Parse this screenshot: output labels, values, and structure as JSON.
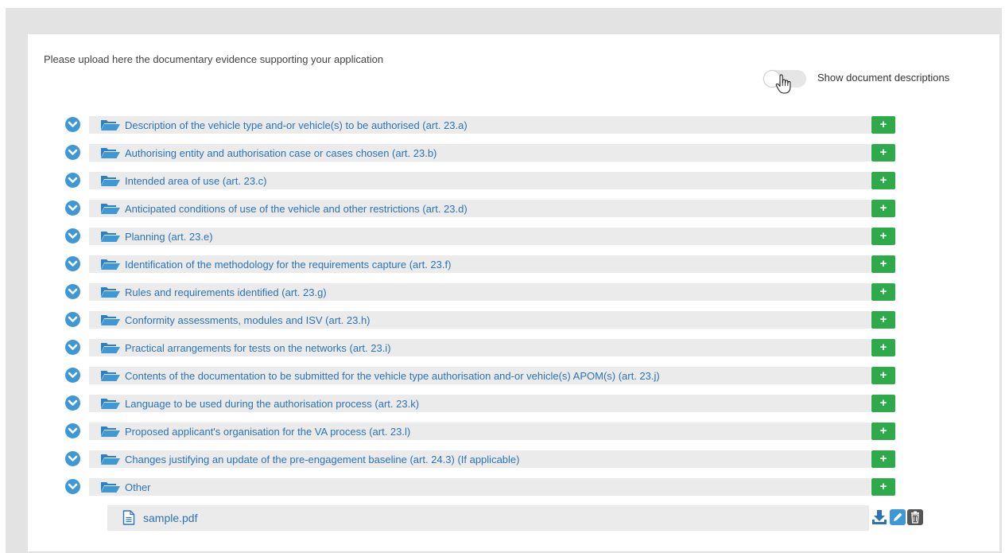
{
  "intro_text": "Please upload here the documentary evidence supporting your application",
  "toggle": {
    "label": "Show document descriptions",
    "enabled": false
  },
  "folders": [
    {
      "label": "Description of the vehicle type and-or vehicle(s) to be authorised (art. 23.a)"
    },
    {
      "label": "Authorising entity and authorisation case or cases chosen (art. 23.b)"
    },
    {
      "label": "Intended area of use (art. 23.c)"
    },
    {
      "label": "Anticipated conditions of use of the vehicle and other restrictions (art. 23.d)"
    },
    {
      "label": "Planning (art. 23.e)"
    },
    {
      "label": "Identification of the methodology for the requirements capture (art. 23.f)"
    },
    {
      "label": "Rules and requirements identified (art. 23.g)"
    },
    {
      "label": "Conformity assessments, modules and ISV (art. 23.h)"
    },
    {
      "label": "Practical arrangements for tests on the networks (art. 23.i)"
    },
    {
      "label": "Contents of the documentation to be submitted for the vehicle type authorisation and-or vehicle(s) APOM(s) (art. 23.j)"
    },
    {
      "label": "Language to be used during the authorisation process (art. 23.k)"
    },
    {
      "label": "Proposed applicant's organisation for the VA process (art. 23.l)"
    },
    {
      "label": "Changes justifying an update of the pre-engagement baseline (art. 24.3) (If applicable)"
    },
    {
      "label": "Other"
    }
  ],
  "add_button_label": "+",
  "file": {
    "name": "sample.pdf"
  },
  "icons": {
    "expand": "chevron-down-icon",
    "folder": "folder-open-icon",
    "file": "file-text-icon",
    "download": "download-icon",
    "edit": "pencil-icon",
    "delete": "trash-icon"
  },
  "colors": {
    "accent_blue": "#3f98d6",
    "link_blue": "#2b73b8",
    "add_green": "#2eaa4a",
    "row_gray": "#ebebeb",
    "frame_gray": "#e3e3e3"
  }
}
